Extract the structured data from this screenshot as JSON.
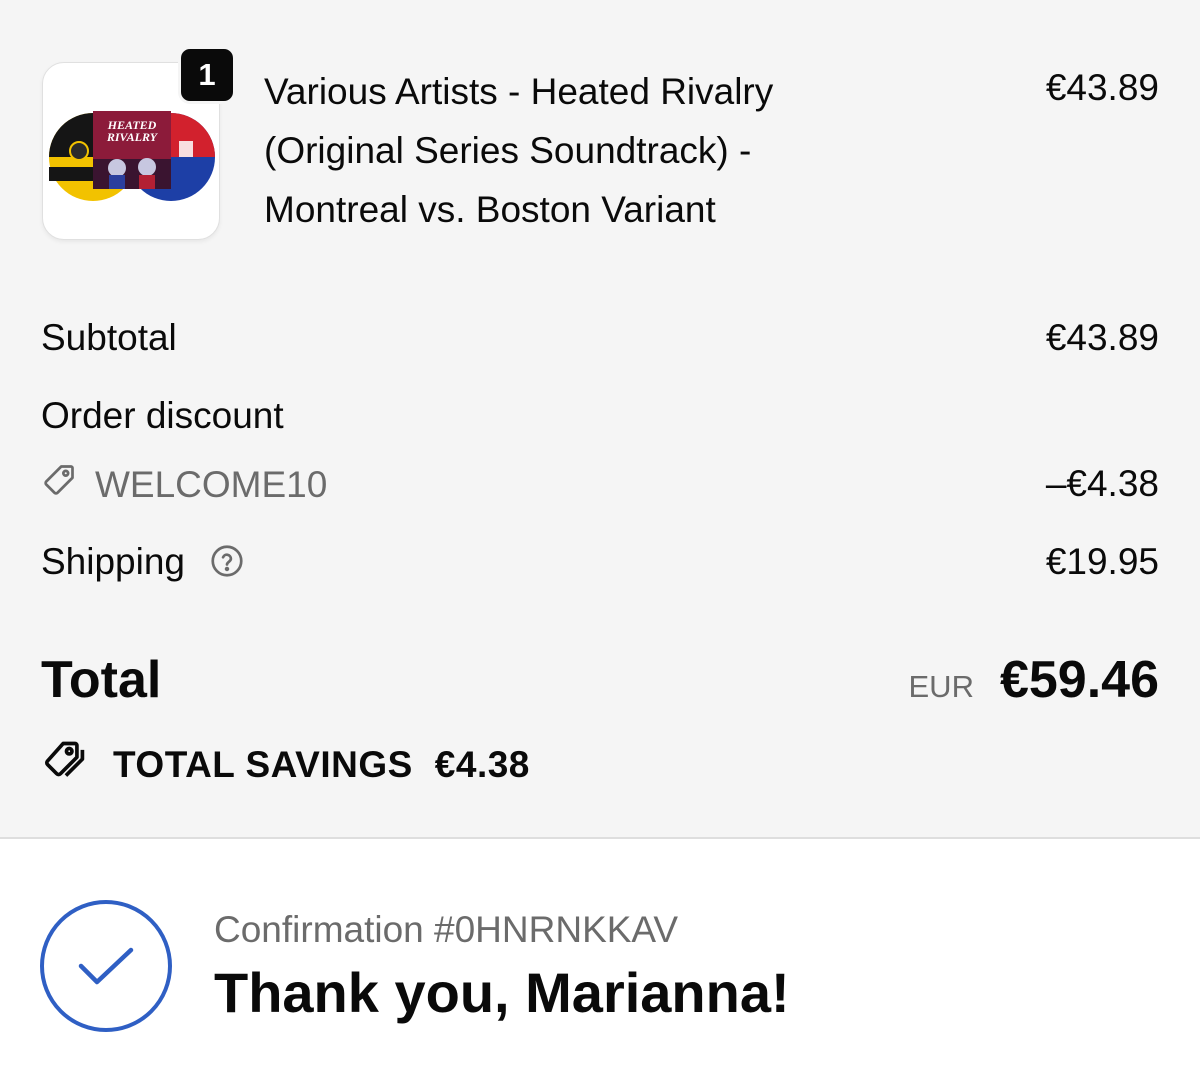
{
  "order": {
    "item": {
      "quantity": "1",
      "title": "Various Artists - Heated Rivalry (Original Series Soundtrack) - Montreal vs. Boston Variant",
      "price": "€43.89",
      "artwork_text": [
        "HEATED",
        "RIVALRY"
      ]
    },
    "subtotal": {
      "label": "Subtotal",
      "value": "€43.89"
    },
    "discount": {
      "label": "Order discount",
      "code": "WELCOME10",
      "value": "–€4.38",
      "icon": "tag-icon"
    },
    "shipping": {
      "label": "Shipping",
      "value": "€19.95",
      "icon": "help-circle-icon"
    },
    "total": {
      "label": "Total",
      "currency": "EUR",
      "value": "€59.46"
    },
    "savings": {
      "label": "TOTAL SAVINGS",
      "value": "€4.38",
      "icon": "tags-icon"
    }
  },
  "confirmation": {
    "number": "Confirmation #0HNRNKKAV",
    "message": "Thank you, Marianna!",
    "icon": "check-circle-icon"
  },
  "colors": {
    "summary_background": "#f5f5f5",
    "accent_blue": "#2f5fc4",
    "muted_text": "#6b6b6b",
    "primary_text": "#0a0a0a"
  }
}
